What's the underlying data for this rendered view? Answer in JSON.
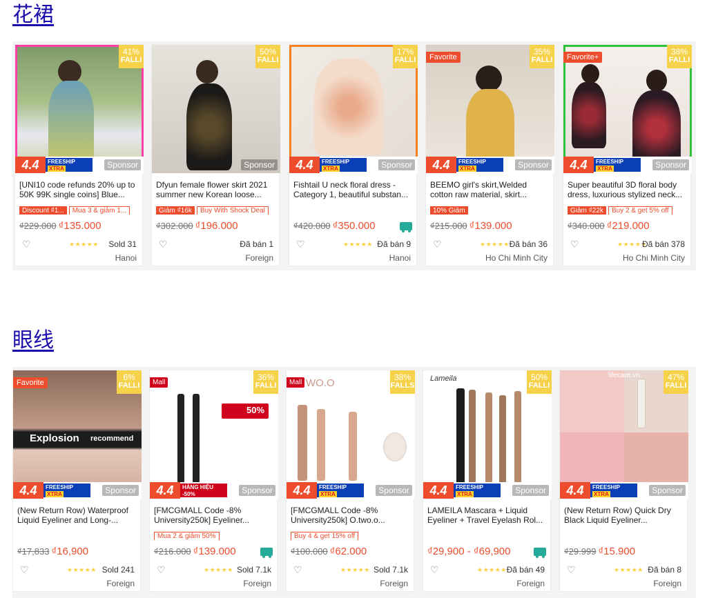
{
  "sections": [
    {
      "title": "花裙",
      "products": [
        {
          "name": "[UNI10 code refunds 20% up to 50K 99K single coins] Blue...",
          "discount": "41%",
          "discount_label": "FALLI",
          "old_price": "₫229.000",
          "price": "₫135.000",
          "tag1": "Discount ₫1...",
          "tag2": "Mua 3 & giảm 1...",
          "sold": "Sold 31",
          "location": "Hanoi",
          "sponsor": "Sponsor",
          "promo": "4.4",
          "freeship": "FREESHIP",
          "xtra": "XTRA",
          "rating": "★★★★★"
        },
        {
          "name": "Dfyun female flower skirt 2021 summer new Korean loose...",
          "discount": "50%",
          "discount_label": "FALLI",
          "old_price": "₫302.000",
          "price": "₫196.000",
          "tag1": "Giảm ₫16k",
          "tag2": "Buy With Shock Deal",
          "sold": "Đã bán 1",
          "location": "Foreign",
          "sponsor": "Sponsor",
          "promo": "4.4",
          "freeship": "FREESHIP",
          "xtra": "XTRA",
          "rating": ""
        },
        {
          "name": "Fishtail U neck floral dress - Category 1, beautiful substan...",
          "discount": "17%",
          "discount_label": "FALLI",
          "old_price": "₫420.000",
          "price": "₫350.000",
          "tag1": "",
          "tag2": "",
          "sold": "Đã bán 9",
          "location": "Hanoi",
          "sponsor": "Sponsor",
          "promo": "4.4",
          "freeship": "FREESHIP",
          "xtra": "XTRA",
          "rating": "★★★★★"
        },
        {
          "name": "BEEMO girl's skirt,Welded cotton raw material, skirt...",
          "discount": "35%",
          "discount_label": "FALLI",
          "badge": "Favorite",
          "old_price": "₫215.000",
          "price": "₫139.000",
          "tag1": "10% Giảm",
          "tag2": "",
          "sold": "Đã bán 36",
          "location": "Ho Chi Minh City",
          "sponsor": "Sponsor",
          "promo": "4.4",
          "freeship": "FREESHIP",
          "xtra": "XTRA",
          "rating": "★★★★★"
        },
        {
          "name": "Super beautiful 3D floral body dress, luxurious stylized neck...",
          "discount": "38%",
          "discount_label": "FALLI",
          "badge": "Favorite+",
          "old_price": "₫340.000",
          "price": "₫219.000",
          "tag1": "Giảm ₫22k",
          "tag2": "Buy 2 & get 5% off",
          "sold": "Đã bán 378",
          "location": "Ho Chi Minh City",
          "sponsor": "Sponsor",
          "promo": "4.4",
          "freeship": "FREESHIP",
          "xtra": "XTRA",
          "rating": "★★★★★"
        }
      ]
    },
    {
      "title": "眼线",
      "products": [
        {
          "name": "(New Return Row) Waterproof Liquid Eyeliner and Long-...",
          "discount": "6%",
          "discount_label": "FALLI",
          "badge": "Favorite",
          "old_price": "₫17,833",
          "price": "₫16,900",
          "tag1": "",
          "tag2": "",
          "sold": "Sold 241",
          "location": "Foreign",
          "sponsor": "Sponsor",
          "promo": "4.4",
          "freeship": "FREESHIP",
          "xtra": "XTRA",
          "rating": "★★★★★",
          "img_text1": "Explosion",
          "img_text2": "recommend"
        },
        {
          "name": "[FMCGMALL Code -8% University250k] Eyeliner...",
          "discount": "36%",
          "discount_label": "FALLI",
          "mall": "Mall",
          "old_price": "₫216.000",
          "price": "₫139.000",
          "tag1": "",
          "tag2": "Mua 2 & giảm 50%",
          "sold": "Sold 7.1k",
          "location": "Foreign",
          "sponsor": "Sponsor",
          "promo": "4.4",
          "freeship": "",
          "xtra": "",
          "rating": "★★★★★",
          "img_text1": "50%",
          "img_text2": "HÀNG HIỆU -50%"
        },
        {
          "name": "[FMCGMALL Code -8% University250k] O.two.o...",
          "discount": "38%",
          "discount_label": "FALLS",
          "mall": "Mall",
          "old_price": "₫100.000",
          "price": "₫62.000",
          "tag1": "",
          "tag2": "Buy 4 & get 15% off",
          "sold": "Sold 7.1k",
          "location": "Foreign",
          "sponsor": "Sponsor",
          "promo": "4.4",
          "freeship": "FREESHIP",
          "xtra": "XTRA",
          "rating": "★★★★★",
          "img_text1": "WO.O"
        },
        {
          "name": "LAMEILA Mascara + Liquid Eyeliner + Travel Eyelash Rol...",
          "discount": "50%",
          "discount_label": "FALLI",
          "old_price": "",
          "price": "₫29,900 - ₫69,900",
          "tag1": "",
          "tag2": "",
          "sold": "Đã bán 49",
          "location": "Foreign",
          "sponsor": "Sponsor",
          "promo": "4.4",
          "freeship": "FREESHIP",
          "xtra": "XTRA",
          "rating": "★★★★★",
          "img_text1": "Lameila"
        },
        {
          "name": "(New Return Row) Quick Dry Black Liquid Eyeliner...",
          "discount": "47%",
          "discount_label": "FALLI",
          "old_price": "₫29.999",
          "price": "₫15.900",
          "tag1": "",
          "tag2": "",
          "sold": "Đã bán 8",
          "location": "Foreign",
          "sponsor": "Sponsor",
          "promo": "4.4",
          "freeship": "FREESHIP",
          "xtra": "XTRA",
          "rating": "★★★★★",
          "img_text1": "lifecare.vn"
        }
      ]
    }
  ],
  "icons": {
    "heart": "heart-outline-icon",
    "truck": "free-shipping-truck-icon"
  },
  "colors": {
    "accent": "#ee4d2d",
    "link": "#1a0dab",
    "star": "#ffce3d",
    "discount_badge": "#f6d24a"
  }
}
